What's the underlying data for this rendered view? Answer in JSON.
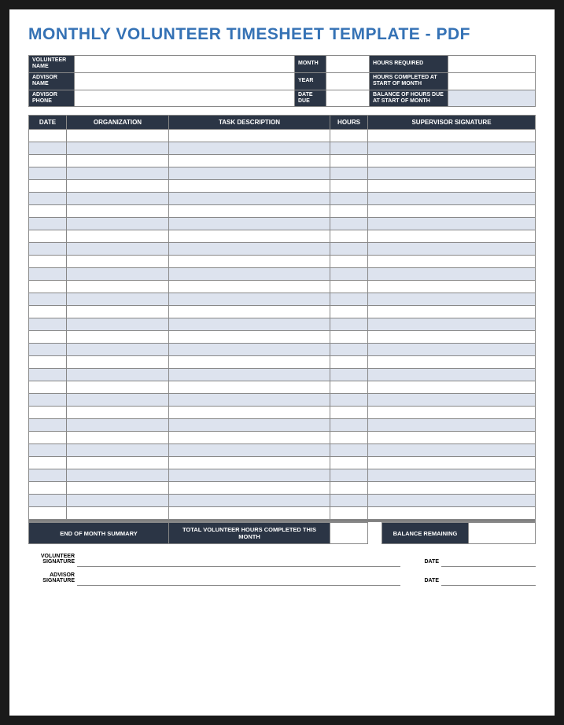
{
  "title": "MONTHLY VOLUNTEER TIMESHEET TEMPLATE - PDF",
  "info": {
    "volunteer_name_label": "VOLUNTEER NAME",
    "advisor_name_label": "ADVISOR NAME",
    "advisor_phone_label": "ADVISOR PHONE",
    "month_label": "MONTH",
    "year_label": "YEAR",
    "date_due_label": "DATE DUE",
    "hours_required_label": "HOURS REQUIRED",
    "hours_completed_label": "HOURS COMPLETED AT START OF MONTH",
    "balance_due_label": "BALANCE OF HOURS DUE AT START OF MONTH",
    "volunteer_name": "",
    "advisor_name": "",
    "advisor_phone": "",
    "month": "",
    "year": "",
    "date_due": "",
    "hours_required": "",
    "hours_completed": "",
    "balance_due": ""
  },
  "columns": {
    "date": "DATE",
    "organization": "ORGANIZATION",
    "task": "TASK DESCRIPTION",
    "hours": "HOURS",
    "supervisor": "SUPERVISOR SIGNATURE"
  },
  "summary": {
    "eom_label": "END OF MONTH SUMMARY",
    "total_label": "TOTAL VOLUNTEER HOURS COMPLETED THIS MONTH",
    "total_value": "",
    "balance_label": "BALANCE REMAINING",
    "balance_value": ""
  },
  "signatures": {
    "volunteer_label": "VOLUNTEER SIGNATURE",
    "advisor_label": "ADVISOR SIGNATURE",
    "date_label": "DATE"
  },
  "chart_data": {
    "type": "table",
    "columns": [
      "DATE",
      "ORGANIZATION",
      "TASK DESCRIPTION",
      "HOURS",
      "SUPERVISOR SIGNATURE"
    ],
    "rows": [
      [
        "",
        "",
        "",
        "",
        ""
      ],
      [
        "",
        "",
        "",
        "",
        ""
      ],
      [
        "",
        "",
        "",
        "",
        ""
      ],
      [
        "",
        "",
        "",
        "",
        ""
      ],
      [
        "",
        "",
        "",
        "",
        ""
      ],
      [
        "",
        "",
        "",
        "",
        ""
      ],
      [
        "",
        "",
        "",
        "",
        ""
      ],
      [
        "",
        "",
        "",
        "",
        ""
      ],
      [
        "",
        "",
        "",
        "",
        ""
      ],
      [
        "",
        "",
        "",
        "",
        ""
      ],
      [
        "",
        "",
        "",
        "",
        ""
      ],
      [
        "",
        "",
        "",
        "",
        ""
      ],
      [
        "",
        "",
        "",
        "",
        ""
      ],
      [
        "",
        "",
        "",
        "",
        ""
      ],
      [
        "",
        "",
        "",
        "",
        ""
      ],
      [
        "",
        "",
        "",
        "",
        ""
      ],
      [
        "",
        "",
        "",
        "",
        ""
      ],
      [
        "",
        "",
        "",
        "",
        ""
      ],
      [
        "",
        "",
        "",
        "",
        ""
      ],
      [
        "",
        "",
        "",
        "",
        ""
      ],
      [
        "",
        "",
        "",
        "",
        ""
      ],
      [
        "",
        "",
        "",
        "",
        ""
      ],
      [
        "",
        "",
        "",
        "",
        ""
      ],
      [
        "",
        "",
        "",
        "",
        ""
      ],
      [
        "",
        "",
        "",
        "",
        ""
      ],
      [
        "",
        "",
        "",
        "",
        ""
      ],
      [
        "",
        "",
        "",
        "",
        ""
      ],
      [
        "",
        "",
        "",
        "",
        ""
      ],
      [
        "",
        "",
        "",
        "",
        ""
      ],
      [
        "",
        "",
        "",
        "",
        ""
      ],
      [
        "",
        "",
        "",
        "",
        ""
      ]
    ]
  }
}
